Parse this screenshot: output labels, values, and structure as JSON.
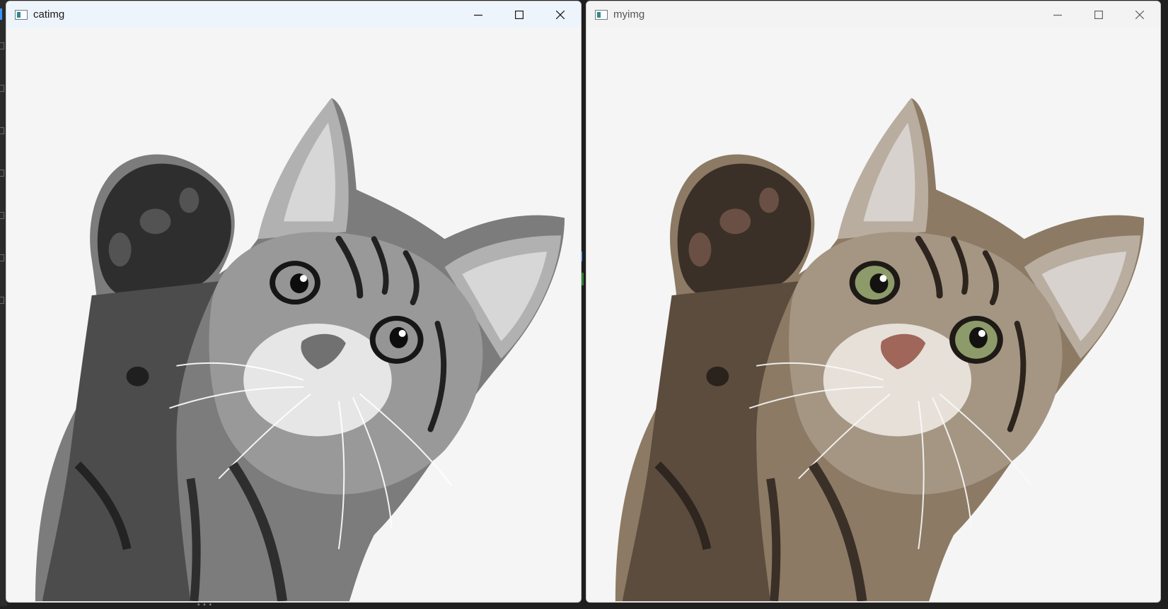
{
  "windows": [
    {
      "title": "catimg",
      "active": true,
      "image": {
        "subject": "tabby kitten raising paw",
        "mode": "grayscale"
      }
    },
    {
      "title": "myimg",
      "active": false,
      "image": {
        "subject": "tabby kitten raising paw",
        "mode": "color"
      }
    }
  ],
  "icons": {
    "app": "image-window-icon",
    "minimize": "minimize-icon",
    "maximize": "maximize-icon",
    "close": "close-icon"
  },
  "colors": {
    "active_titlebar": "#eef4fb",
    "inactive_titlebar": "#f3f3f3",
    "canvas_bg": "#f5f5f5",
    "accent": "#3794ff"
  }
}
